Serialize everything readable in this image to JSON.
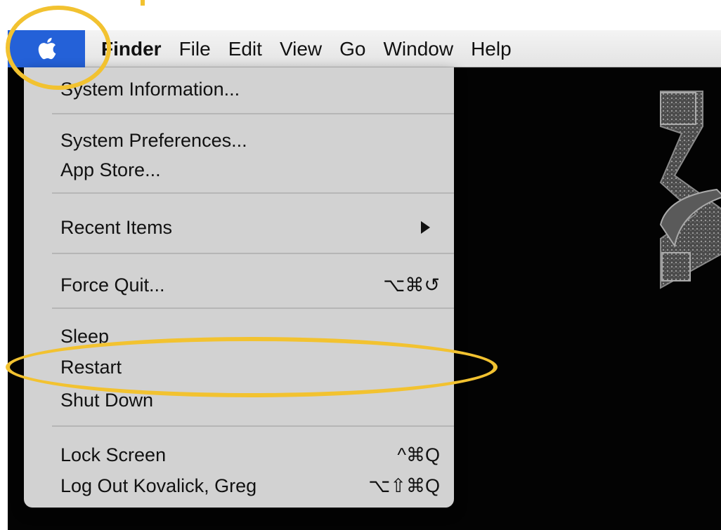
{
  "menubar": {
    "apple_icon": "apple-logo-icon",
    "app_name": "Finder",
    "menus": [
      "File",
      "Edit",
      "View",
      "Go",
      "Window",
      "Help"
    ]
  },
  "apple_menu": {
    "items": [
      {
        "label": "System Information...",
        "shortcut": ""
      },
      {
        "label": "System Preferences...",
        "shortcut": ""
      },
      {
        "label": "App Store...",
        "shortcut": ""
      },
      {
        "label": "Recent Items",
        "shortcut": "",
        "submenu_icon": "triangle-right-icon"
      },
      {
        "label": "Force Quit...",
        "shortcut": "⌥⌘↺"
      },
      {
        "label": "Sleep",
        "shortcut": ""
      },
      {
        "label": "Restart",
        "shortcut": ""
      },
      {
        "label": "Shut Down",
        "shortcut": ""
      },
      {
        "label": "Lock Screen",
        "shortcut": "^⌘Q"
      },
      {
        "label": "Log Out Kovalick, Greg",
        "shortcut": "⌥⇧⌘Q"
      }
    ]
  },
  "colors": {
    "highlight": "#2461d8",
    "annotation": "#f2c230",
    "menu_bg": "#d2d2d2",
    "desktop": "#030303"
  }
}
